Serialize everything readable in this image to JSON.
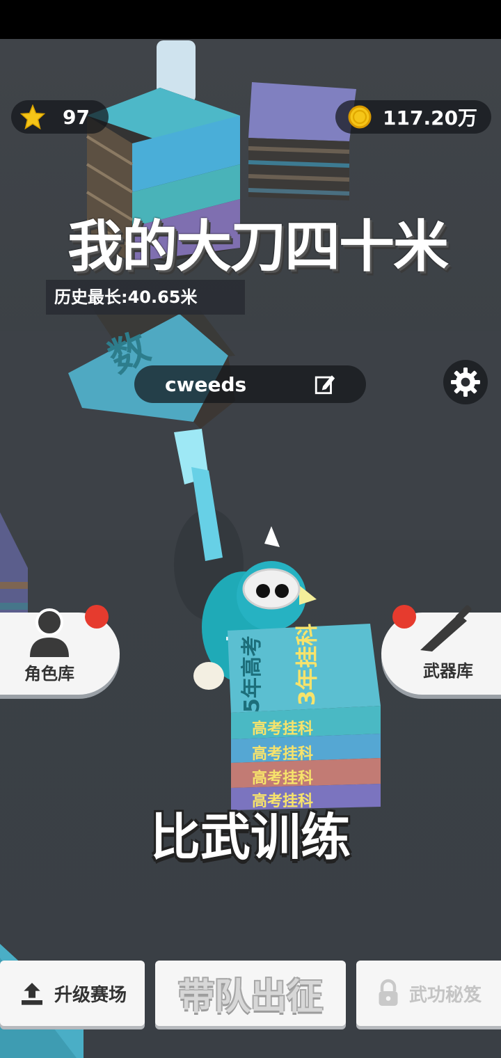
{
  "hud": {
    "stars": "97",
    "coins": "117.20万"
  },
  "title": {
    "line": "我的大刀四十米",
    "record": "历史最长:40.65米"
  },
  "player": {
    "name": "cweeds"
  },
  "side_buttons": {
    "characters": "角色库",
    "weapons": "武器库"
  },
  "training": "比武训练",
  "bottom": {
    "upgrade": "升级赛场",
    "lead": "带队出征",
    "secret": "武功秘笈"
  },
  "book_labels": {
    "big_front": "5年高考",
    "big_side": "3年挂科",
    "strip": "高考挂科"
  },
  "colors": {
    "accent_red": "#e63b2e",
    "gold": "#f5c518",
    "teal": "#27a7b8"
  }
}
